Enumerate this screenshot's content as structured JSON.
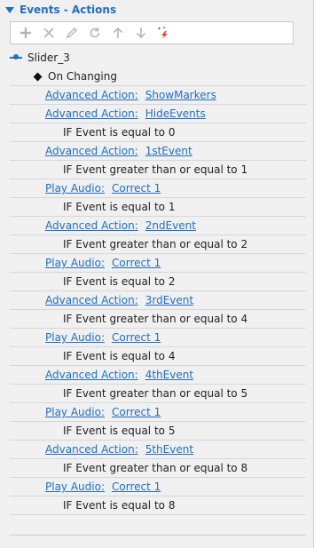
{
  "panel": {
    "title": "Events - Actions"
  },
  "toolbar": [
    {
      "name": "add-icon"
    },
    {
      "name": "delete-icon"
    },
    {
      "name": "edit-icon"
    },
    {
      "name": "refresh-icon"
    },
    {
      "name": "move-up-icon"
    },
    {
      "name": "move-down-icon"
    },
    {
      "name": "magic-wand-icon"
    }
  ],
  "tree": {
    "object": "Slider_3",
    "event": "On Changing",
    "rows": [
      {
        "kind": "action",
        "type": "Advanced Action:",
        "target": "ShowMarkers"
      },
      {
        "kind": "action",
        "type": "Advanced Action:",
        "target": "HideEvents"
      },
      {
        "kind": "condition",
        "text": "IF Event is equal to 0"
      },
      {
        "kind": "action",
        "type": "Advanced Action:",
        "target": "1stEvent"
      },
      {
        "kind": "condition",
        "text": "IF Event greater than or equal to 1"
      },
      {
        "kind": "action",
        "type": "Play Audio:",
        "target": "Correct 1"
      },
      {
        "kind": "condition",
        "text": "IF Event is equal to 1"
      },
      {
        "kind": "action",
        "type": "Advanced Action:",
        "target": "2ndEvent"
      },
      {
        "kind": "condition",
        "text": "IF Event greater than or equal to 2"
      },
      {
        "kind": "action",
        "type": "Play Audio:",
        "target": "Correct 1"
      },
      {
        "kind": "condition",
        "text": "IF Event is equal to 2"
      },
      {
        "kind": "action",
        "type": "Advanced Action:",
        "target": "3rdEvent"
      },
      {
        "kind": "condition",
        "text": "IF Event greater than or equal to 4"
      },
      {
        "kind": "action",
        "type": "Play Audio:",
        "target": "Correct 1"
      },
      {
        "kind": "condition",
        "text": "IF Event is equal to 4"
      },
      {
        "kind": "action",
        "type": "Advanced Action:",
        "target": "4thEvent"
      },
      {
        "kind": "condition",
        "text": "IF Event greater than or equal to 5"
      },
      {
        "kind": "action",
        "type": "Play Audio:",
        "target": "Correct 1"
      },
      {
        "kind": "condition",
        "text": "IF Event is equal to 5"
      },
      {
        "kind": "action",
        "type": "Advanced Action:",
        "target": "5thEvent"
      },
      {
        "kind": "condition",
        "text": "IF Event greater than or equal to 8"
      },
      {
        "kind": "action",
        "type": "Play Audio:",
        "target": "Correct 1"
      },
      {
        "kind": "condition",
        "text": "IF Event is equal to 8"
      }
    ]
  },
  "colors": {
    "accent": "#1f6fc5",
    "background": "#f0f0f0",
    "toolbar_bg": "#ffffff",
    "icon_disabled": "#b4b4b4",
    "wand_spark": "#e2502c"
  }
}
